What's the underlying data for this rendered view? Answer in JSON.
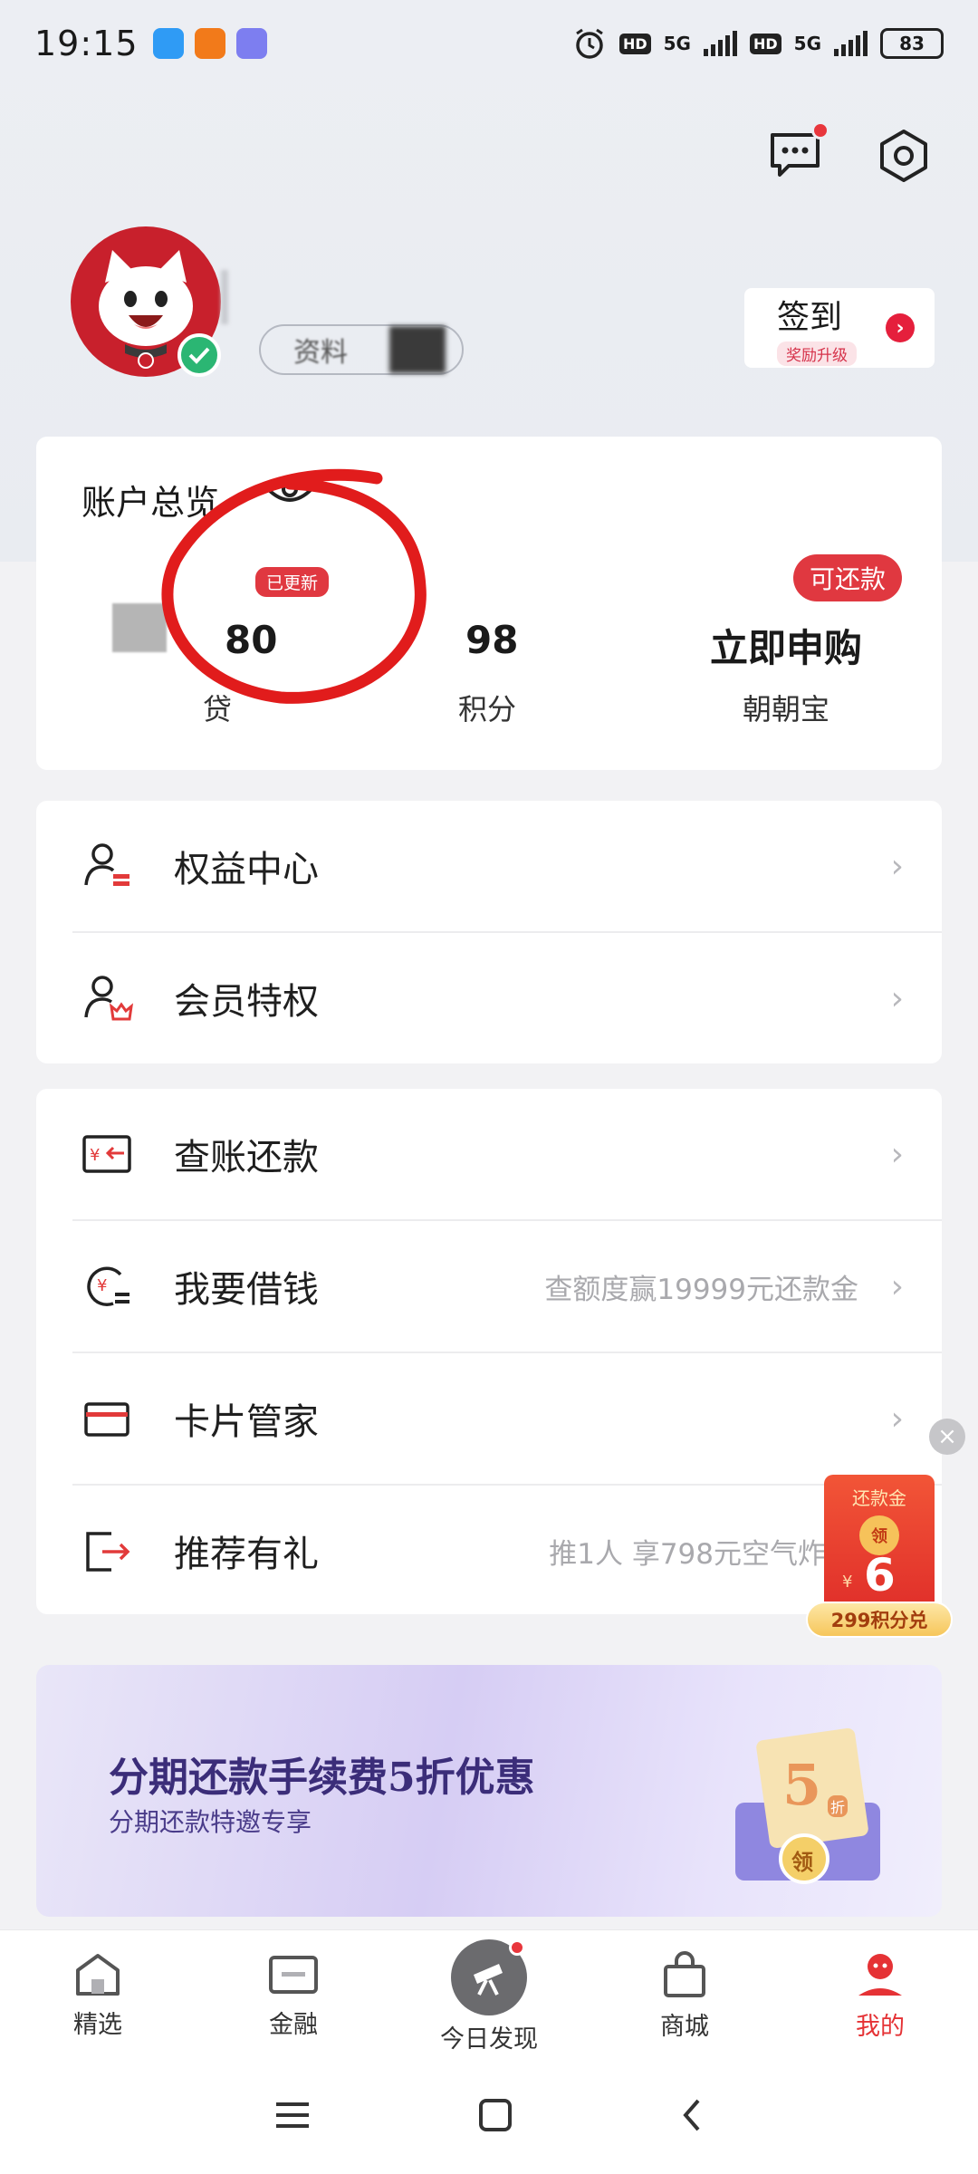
{
  "status_bar": {
    "time": "19:15",
    "network_1": "5G",
    "network_2": "5G",
    "battery": "83"
  },
  "profile": {
    "chip_label": "资料"
  },
  "signin": {
    "title": "签到",
    "subtitle": "奖励升级"
  },
  "account": {
    "title": "账户总览",
    "updated_badge": "已更新",
    "repay_badge": "可还款",
    "stats": [
      {
        "value": "80",
        "label": "贷"
      },
      {
        "value": "98",
        "label": "积分"
      },
      {
        "value": "立即申购",
        "label": "朝朝宝"
      }
    ]
  },
  "menu_group_1": [
    {
      "label": "权益中心",
      "hint": ""
    },
    {
      "label": "会员特权",
      "hint": ""
    }
  ],
  "menu_group_2": [
    {
      "label": "查账还款",
      "hint": ""
    },
    {
      "label": "我要借钱",
      "hint": "查额度赢19999元还款金"
    },
    {
      "label": "卡片管家",
      "hint": ""
    },
    {
      "label": "推荐有礼",
      "hint": "推1人 享798元空气炸"
    }
  ],
  "float_packet": {
    "title": "还款金",
    "coin": "领",
    "amount": "6",
    "currency": "¥",
    "points_label": "299积分兑"
  },
  "banner": {
    "headline": "分期还款手续费5折优惠",
    "subline": "分期还款特邀专享",
    "ticket_number": "5",
    "ticket_unit": "折",
    "ticket_button": "领"
  },
  "tabs": [
    {
      "label": "精选",
      "icon": "home-icon"
    },
    {
      "label": "金融",
      "icon": "wallet-icon"
    },
    {
      "label": "今日发现",
      "icon": "telescope-icon"
    },
    {
      "label": "商城",
      "icon": "shopping-bag-icon"
    },
    {
      "label": "我的",
      "icon": "profile-icon"
    }
  ],
  "colors": {
    "accent": "#e53235",
    "banner_text": "#3b2d79"
  }
}
